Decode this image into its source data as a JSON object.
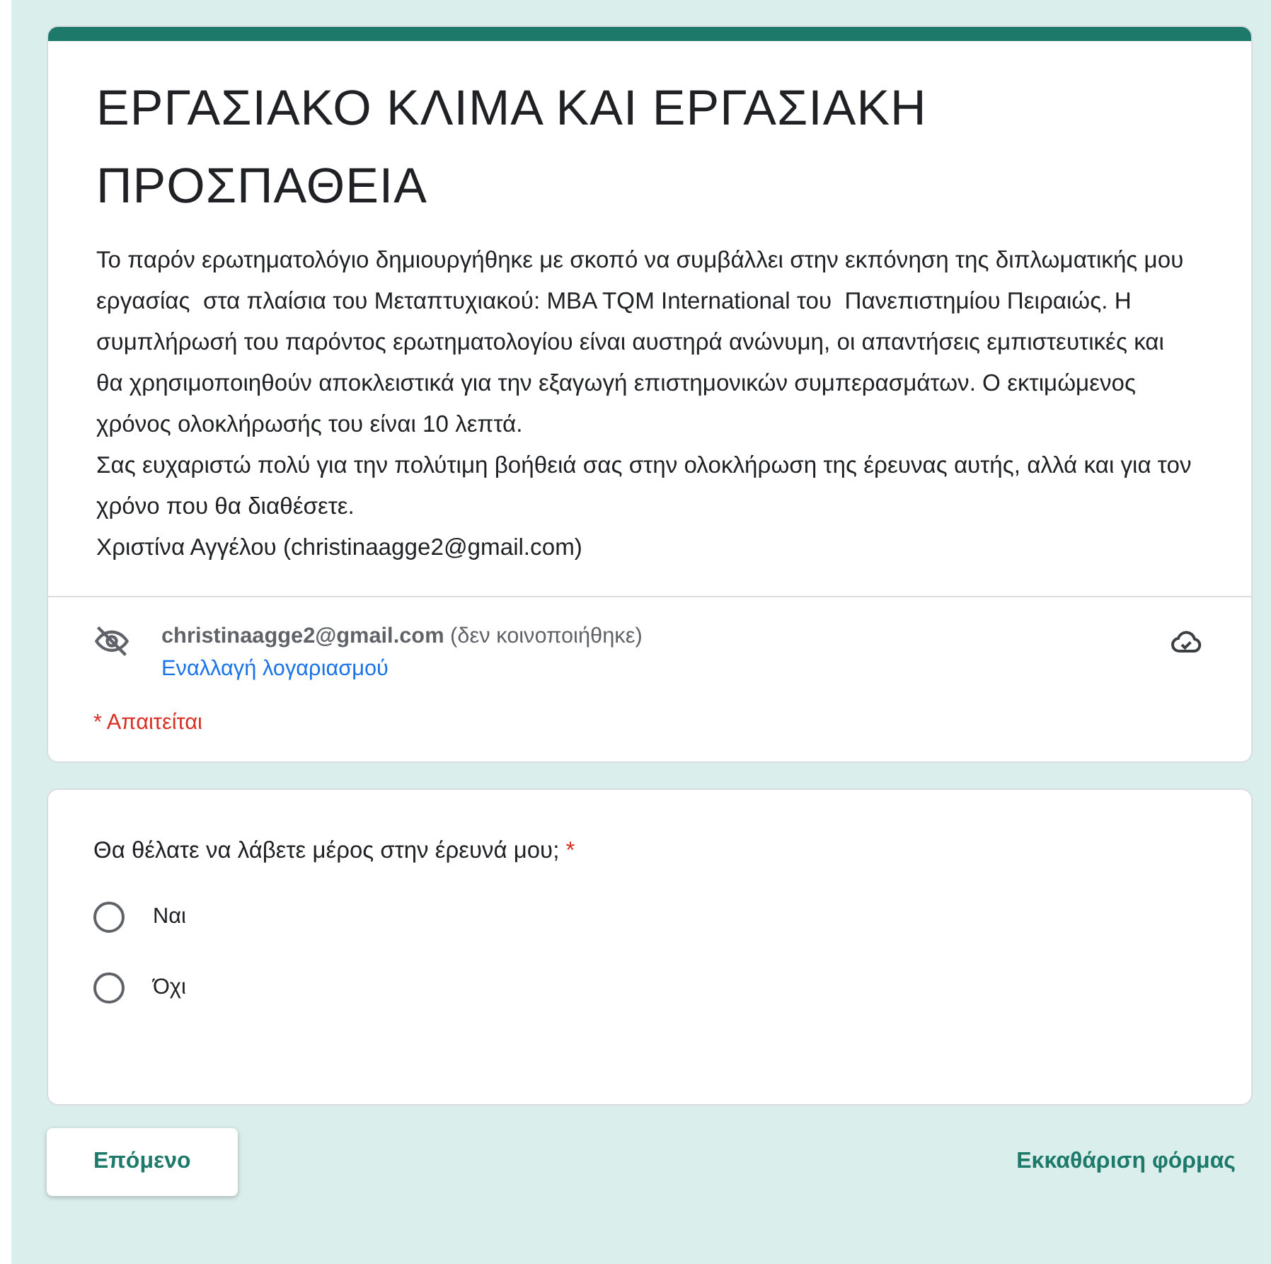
{
  "header": {
    "title": "ΕΡΓΑΣΙΑΚΟ ΚΛΙΜΑ ΚΑΙ ΕΡΓΑΣΙΑΚΗ ΠΡΟΣΠΑΘΕΙΑ",
    "description": [
      "Το παρόν ερωτηματολόγιο δημιουργήθηκε με σκοπό να συμβάλλει στην εκπόνηση της διπλωματικής μου εργασίας  στα πλαίσια του Μεταπτυχιακού: MBA TQM International του  Πανεπιστημίου Πειραιώς. Η συμπλήρωσή του παρόντος ερωτηματολογίου είναι αυστηρά ανώνυμη, οι απαντήσεις εμπιστευτικές και θα χρησιμοποιηθούν αποκλειστικά για την εξαγωγή επιστημονικών συμπερασμάτων. Ο εκτιμώμενος χρόνος ολοκλήρωσής του είναι 10 λεπτά.",
      "Σας ευχαριστώ πολύ για την πολύτιμη βοήθειά σας στην ολοκλήρωση της έρευνας αυτής, αλλά και για τον χρόνο που θα διαθέσετε.",
      "Χριστίνα Αγγέλου (christinaagge2@gmail.com)"
    ],
    "account": {
      "email": "christinaagge2@gmail.com",
      "note": "(δεν κοινοποιήθηκε)",
      "switch_link": "Εναλλαγή λογαριασμού"
    },
    "required_note": "* Απαιτείται"
  },
  "question": {
    "text": "Θα θέλατε να λάβετε μέρος στην έρευνά μου;",
    "required_mark": "*",
    "options": [
      {
        "label": "Ναι",
        "selected": false
      },
      {
        "label": "Όχι",
        "selected": false
      }
    ]
  },
  "buttons": {
    "next": "Επόμενο",
    "clear": "Εκκαθάριση φόρμας"
  }
}
